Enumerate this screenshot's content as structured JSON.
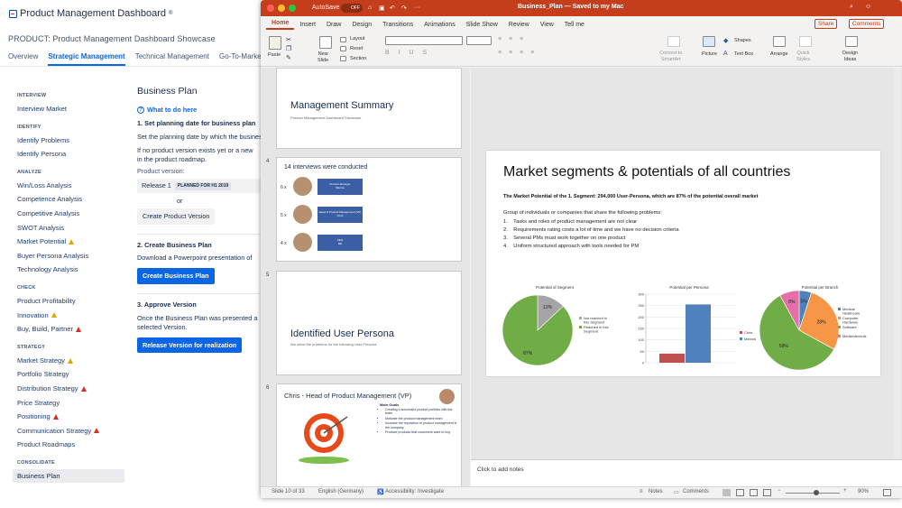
{
  "app": {
    "logo_text": "Product Management Dashboard",
    "logo_mark": "®",
    "product_title": "PRODUCT: Product Management Dashboard Showcase",
    "tabs": [
      "Overview",
      "Strategic Management",
      "Technical Management",
      "Go-To-Market"
    ],
    "active_tab": "Strategic Management"
  },
  "sidebar": {
    "sections": [
      {
        "title": "INTERVIEW",
        "items": [
          {
            "label": "Interview Market",
            "warn": ""
          }
        ]
      },
      {
        "title": "IDENTIFY",
        "items": [
          {
            "label": "Identify Problems",
            "warn": ""
          },
          {
            "label": "Identify Persona",
            "warn": ""
          }
        ]
      },
      {
        "title": "ANALYZE",
        "items": [
          {
            "label": "Win/Loss Analysis",
            "warn": ""
          },
          {
            "label": "Competence Analysis",
            "warn": ""
          },
          {
            "label": "Competitive Analysis",
            "warn": ""
          },
          {
            "label": "SWOT Analysis",
            "warn": ""
          },
          {
            "label": "Market Potential",
            "warn": "yellow"
          },
          {
            "label": "Buyer Persona Analysis",
            "warn": ""
          },
          {
            "label": "Technology Analysis",
            "warn": ""
          }
        ]
      },
      {
        "title": "CHECK",
        "items": [
          {
            "label": "Product Profitability",
            "warn": ""
          },
          {
            "label": "Innovation",
            "warn": "yellow"
          },
          {
            "label": "Buy, Build, Partner",
            "warn": "red"
          }
        ]
      },
      {
        "title": "STRATEGY",
        "items": [
          {
            "label": "Market Strategy",
            "warn": "yellow"
          },
          {
            "label": "Portfolio Strategy",
            "warn": ""
          },
          {
            "label": "Distribution Strategy",
            "warn": "red"
          },
          {
            "label": "Price Strategy",
            "warn": ""
          },
          {
            "label": "Positioning",
            "warn": "red"
          },
          {
            "label": "Communication Strategy",
            "warn": "red"
          },
          {
            "label": "Product Roadmaps",
            "warn": ""
          }
        ]
      },
      {
        "title": "CONSOLIDATE",
        "items": [
          {
            "label": "Business Plan",
            "warn": "",
            "selected": true
          }
        ]
      }
    ]
  },
  "content": {
    "title": "Business Plan",
    "help_link": "What to do here",
    "step1_title": "1. Set planning date for business plan",
    "step1_text1": "Set the planning date by which the business",
    "step1_text2": "If no product version exists yet or a new",
    "step1_text3": "in the product roadmap.",
    "product_version_label": "Product version:",
    "release_label": "Release 1",
    "release_plan": "PLANNED FOR H1 2019",
    "or_label": "or",
    "create_version_btn": "Create Product Version",
    "step2_title": "2. Create Business Plan",
    "step2_text": "Download a Powerpoint presentation of",
    "create_plan_btn": "Create Business Plan",
    "step3_title": "3. Approve Version",
    "step3_text1": "Once the Business Plan was presented a",
    "step3_text2": "selected Version.",
    "release_btn": "Release Version for realization"
  },
  "ppt": {
    "autosave": "AutoSave",
    "autosave_state": "OFF",
    "doc_title": "Business_Plan — Saved to my Mac",
    "ribbon_tabs": [
      "Home",
      "Insert",
      "Draw",
      "Design",
      "Transitions",
      "Animations",
      "Slide Show",
      "Review",
      "View",
      "Tell me"
    ],
    "share": "Share",
    "comments": "Comments",
    "ribbon": {
      "paste": "Paste",
      "new_slide": "New\nSlide",
      "layout": "Layout",
      "reset": "Reset",
      "section": "Section",
      "convert": "Convert to\nSmartArt",
      "picture": "Picture",
      "shapes": "Shapes",
      "textbox": "Text Box",
      "arrange": "Arrange",
      "quick_styles": "Quick\nStyles",
      "design_ideas": "Design\nIdeas"
    },
    "thumbs": [
      {
        "num": "",
        "title": "Management Summary",
        "sub": "Product Management Dashboard Showcase"
      },
      {
        "num": "4",
        "title": "14 interviews were conducted",
        "rows": [
          {
            "count": "6 x",
            "l1": "Product Manager",
            "l2": "Marcus"
          },
          {
            "count": "5 x",
            "l1": "Head of Product Management (VP)",
            "l2": "Chris"
          },
          {
            "count": "4 x",
            "l1": "CEO",
            "l2": "Bill"
          }
        ]
      },
      {
        "num": "5",
        "title": "Identified User Persona",
        "sub": "We solve the problems for the following User Persona"
      },
      {
        "num": "6",
        "title": "Chris - Head of Product Management (VP)",
        "goals_title": "Main Goals",
        "goals": [
          "Creating a successful product portfolio with the team",
          "Motivate the product management team",
          "Increase the reputation of product management in the company",
          "Produce products that customers want to buy"
        ]
      }
    ],
    "slide": {
      "title": "Market segments & potentials of all countries",
      "subtitle": "The Market Potential of the 1. Segment: 294.000 User-Persona, which are 87% of the potential overall market",
      "intro": "Group of individuals or companies that share the following problems:",
      "problems": [
        "1.    Tasks and roles of product management are not clear",
        "2.    Requirements rating costs a lot of time and we have no decision criteria",
        "3.    Several PMs must work together on one product",
        "4.    Uniform structured approach with tools needed for PM"
      ]
    },
    "notes_placeholder": "Click to add notes",
    "status": {
      "slide": "Slide 10 of 33",
      "language": "English (Germany)",
      "accessibility": "Accessibility: Investigate",
      "notes": "Notes",
      "comments": "Comments",
      "zoom": "90%"
    }
  },
  "chart_data": [
    {
      "type": "pie",
      "title": "Potential of Segment",
      "categories": [
        "Not reached in this Segment",
        "Reached in this Segment"
      ],
      "values": [
        13,
        87
      ],
      "data_labels": [
        "13%",
        "87%"
      ],
      "colors": [
        "#a5a5a5",
        "#70ad47"
      ],
      "legend": "right"
    },
    {
      "type": "bar",
      "title": "Potential per Persona",
      "categories": [
        ""
      ],
      "series": [
        {
          "name": "Chris",
          "values": [
            40
          ]
        },
        {
          "name": "Marcus",
          "values": [
            255
          ]
        }
      ],
      "colors": [
        "#c0504d",
        "#4f81bd"
      ],
      "ylim": [
        0,
        300
      ],
      "yticks": [
        "0",
        "50",
        "100",
        "150",
        "200",
        "250",
        "300"
      ],
      "legend": "right"
    },
    {
      "type": "pie",
      "title": "Potential per Branch",
      "categories": [
        "Medical Healthcare",
        "Computer Hardware",
        "Software",
        "Medizintechnik"
      ],
      "values": [
        5,
        28,
        59,
        8
      ],
      "data_labels": [
        "5%",
        "28%",
        "59%",
        "8%"
      ],
      "colors": [
        "#4f81bd",
        "#f79646",
        "#70ad47",
        "#e56fa6"
      ],
      "legend": "right"
    }
  ]
}
